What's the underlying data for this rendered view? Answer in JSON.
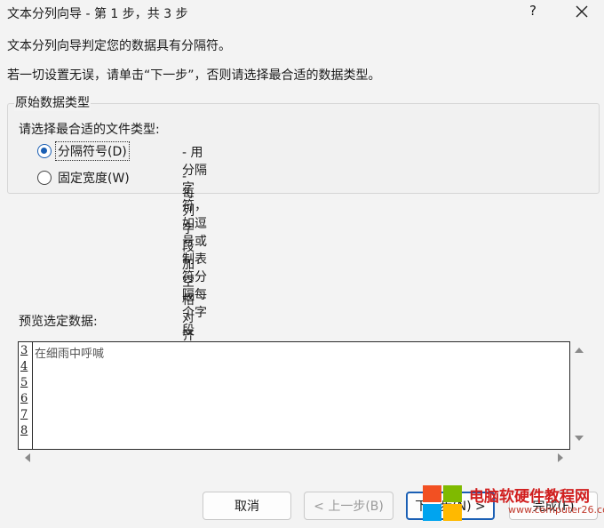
{
  "window": {
    "title": "文本分列向导 - 第 1 步，共 3 步",
    "help": "?"
  },
  "intro": {
    "line1": "文本分列向导判定您的数据具有分隔符。",
    "line2": "若一切设置无误，请单击“下一步”，否则请选择最合适的数据类型。"
  },
  "original_type": {
    "legend": "原始数据类型",
    "prompt": "请选择最合适的文件类型:",
    "options": [
      {
        "label": "分隔符号(D)",
        "desc": "- 用分隔字符，如逗号或制表符分隔每个字段",
        "selected": true
      },
      {
        "label": "固定宽度(W)",
        "desc": "- 每列字段加空格对齐",
        "selected": false
      }
    ]
  },
  "preview": {
    "label": "预览选定数据:",
    "rows": [
      {
        "num": "3",
        "text": "在细雨中呼喊"
      },
      {
        "num": "4",
        "text": ""
      },
      {
        "num": "5",
        "text": ""
      },
      {
        "num": "6",
        "text": ""
      },
      {
        "num": "7",
        "text": ""
      },
      {
        "num": "8",
        "text": ""
      }
    ]
  },
  "buttons": {
    "cancel": "取消",
    "back": "< 上一步(B)",
    "next": "下一步(N) >",
    "finish": "完成(F)"
  },
  "watermark": {
    "text": "电脑软硬件教程网",
    "url": "www.computer26.com"
  },
  "colors": {
    "accent": "#1a5fb4",
    "dialog_bg": "#f3f3f3",
    "watermark_red": "#d11f1f"
  }
}
